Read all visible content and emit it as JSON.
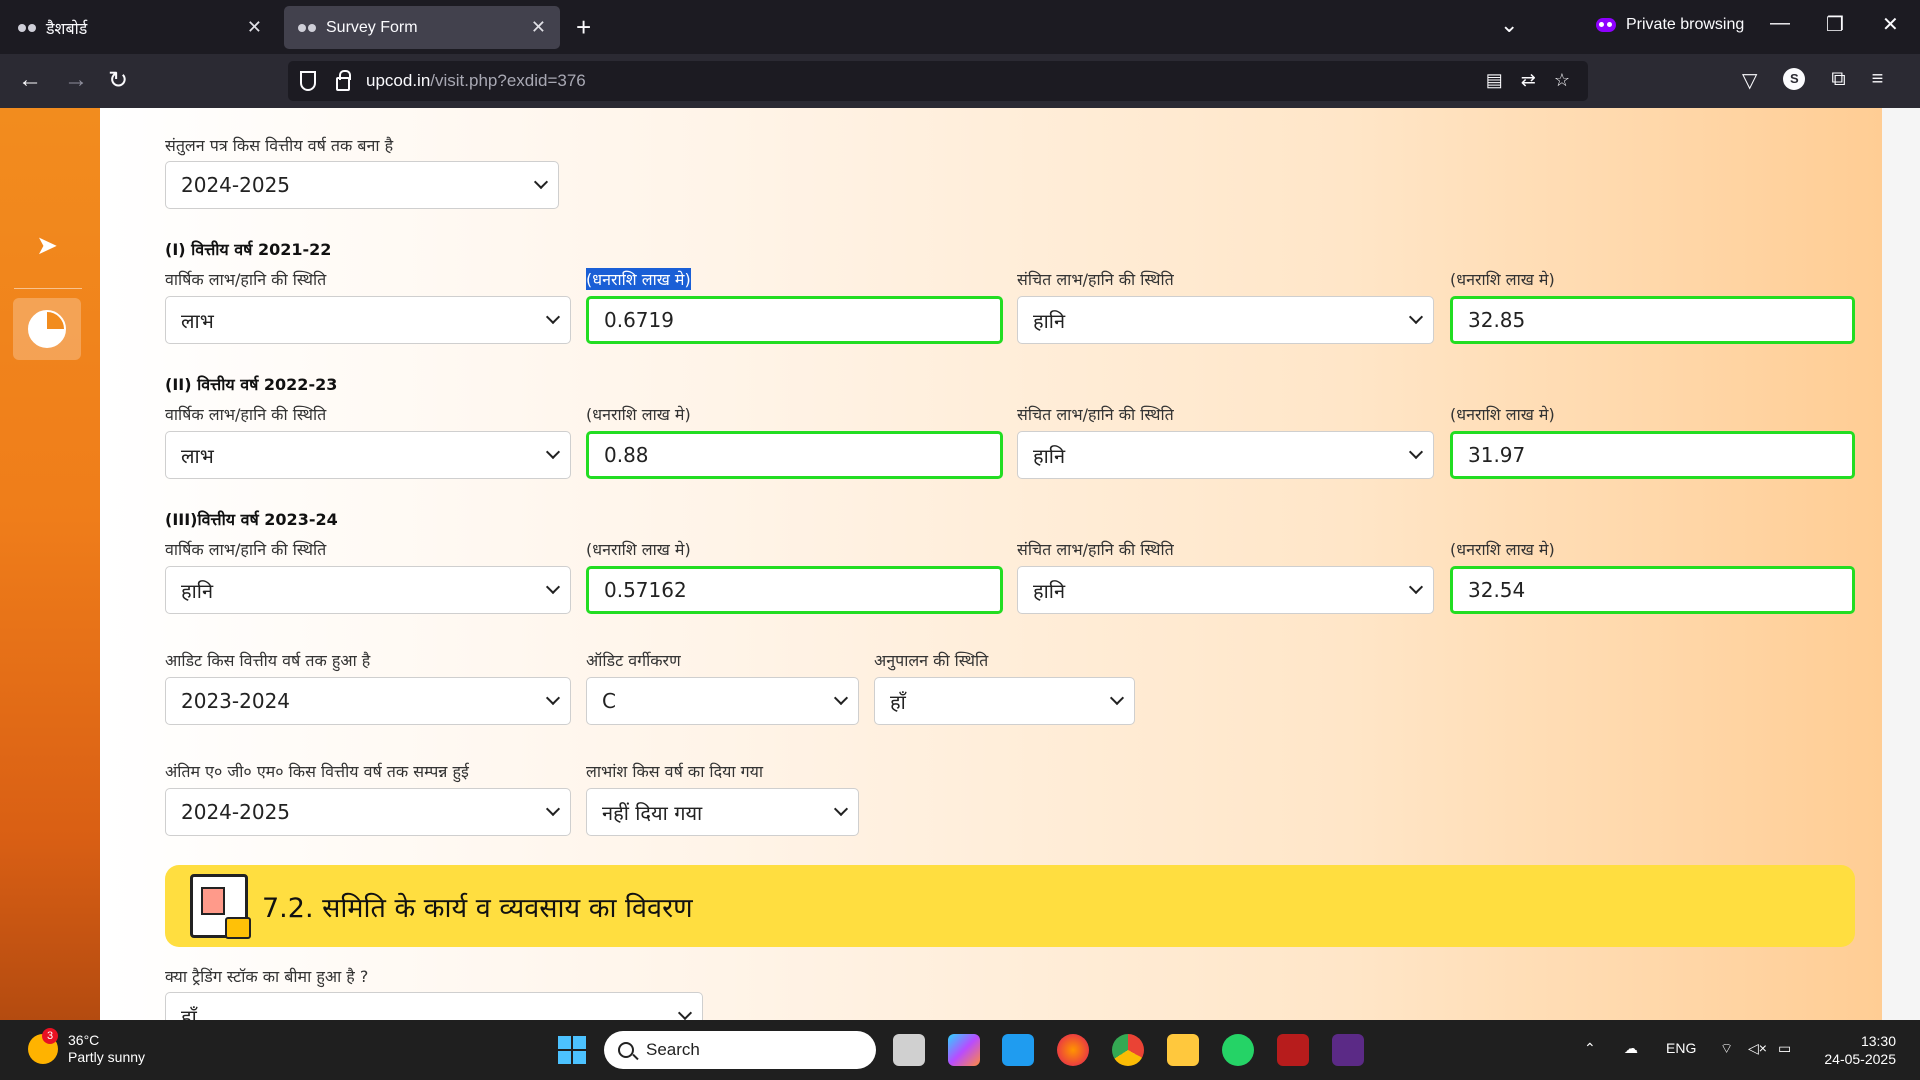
{
  "browser": {
    "tabs": [
      {
        "label": "डैशबोर्ड",
        "active": false
      },
      {
        "label": "Survey Form",
        "active": true
      }
    ],
    "private_label": "Private browsing",
    "url_host": "upcod.in",
    "url_path": "/visit.php?exdid=376",
    "profile_initial": "S"
  },
  "form": {
    "balance_sheet_label": "संतुलन पत्र किस वित्तीय वर्ष तक बना है",
    "balance_sheet_value": "2024-2025",
    "years": [
      {
        "heading": "(I) वित्तीय वर्ष 2021-22",
        "annual_label": "वार्षिक लाभ/हानि की स्थिति",
        "annual_value": "लाभ",
        "amount_label": "(धनराशि लाख मे)",
        "amount_value": "0.6719",
        "cum_label": "संचित लाभ/हानि की स्थिति",
        "cum_value": "हानि",
        "cum_amount_label": "(धनराशि लाख मे)",
        "cum_amount_value": "32.85"
      },
      {
        "heading": "(II) वित्तीय वर्ष 2022-23",
        "annual_label": "वार्षिक लाभ/हानि की स्थिति",
        "annual_value": "लाभ",
        "amount_label": "(धनराशि लाख मे)",
        "amount_value": "0.88",
        "cum_label": "संचित लाभ/हानि की स्थिति",
        "cum_value": "हानि",
        "cum_amount_label": "(धनराशि लाख मे)",
        "cum_amount_value": "31.97"
      },
      {
        "heading": "(III)वित्तीय वर्ष 2023-24",
        "annual_label": "वार्षिक लाभ/हानि की स्थिति",
        "annual_value": "हानि",
        "amount_label": "(धनराशि लाख मे)",
        "amount_value": "0.57162",
        "cum_label": "संचित लाभ/हानि की स्थिति",
        "cum_value": "हानि",
        "cum_amount_label": "(धनराशि लाख मे)",
        "cum_amount_value": "32.54"
      }
    ],
    "audit_year_label": "आडिट किस वित्तीय वर्ष तक हुआ है",
    "audit_year_value": "2023-2024",
    "audit_class_label": "ऑडिट वर्गीकरण",
    "audit_class_value": "C",
    "compliance_label": "अनुपालन की स्थिति",
    "compliance_value": "हाँ",
    "agm_label": "अंतिम ए० जी० एम० किस वित्तीय वर्ष तक सम्पन्न हुई",
    "agm_value": "2024-2025",
    "dividend_label": "लाभांश किस वर्ष का दिया गया",
    "dividend_value": "नहीं दिया गया",
    "section_title": "7.2. समिति के कार्य व व्यवसाय का विवरण",
    "insurance_label": "क्या ट्रैडिंग स्टॉक का बीमा हुआ है ?",
    "insurance_value": "हाँ"
  },
  "taskbar": {
    "weather_temp": "36°C",
    "weather_desc": "Partly sunny",
    "weather_badge": "3",
    "search_placeholder": "Search",
    "lang": "ENG",
    "time": "13:30",
    "date": "24-05-2025"
  }
}
